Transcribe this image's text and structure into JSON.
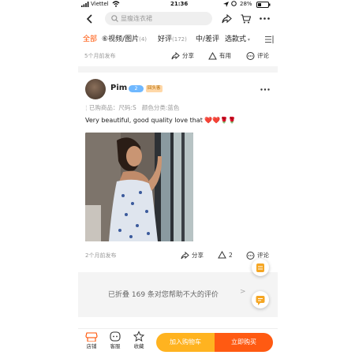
{
  "status": {
    "carrier": "Viettel",
    "time": "21:36",
    "battery": "28%"
  },
  "search": {
    "placeholder": "显瘦连衣裙"
  },
  "tabs": [
    {
      "label": "全部",
      "count": ""
    },
    {
      "label": "⑥视频/图片",
      "count": "(4)"
    },
    {
      "label": "好评",
      "count": "(172)"
    },
    {
      "label": "中/差评",
      "count": ""
    },
    {
      "label": "选款式",
      "count": ""
    }
  ],
  "prev_review": {
    "time": "5个月前发布",
    "share": "分享",
    "useful": "有用",
    "comment": "评论"
  },
  "review": {
    "user": "Pim",
    "vip_badge": "2",
    "repeat_badge": "回头客",
    "purchased_label": "已购商品：",
    "size": "尺码:S",
    "color": "颜色分类:蓝色",
    "text": "Very beautiful, good quality love that ❤️❤️🌹🌹",
    "time": "2个月前发布",
    "share": "分享",
    "likes": "2",
    "comment": "评论"
  },
  "folded": {
    "text": "已折叠 169 条对您帮助不大的评价",
    "arrow": ">"
  },
  "bottom": {
    "shop": "店铺",
    "service": "客服",
    "favorite": "收藏",
    "add_cart": "加入购物车",
    "buy_now": "立即购买"
  },
  "colors": {
    "accent": "#ff5000",
    "add_cart": "#ffb320",
    "buy_now": "#ff5a12"
  }
}
